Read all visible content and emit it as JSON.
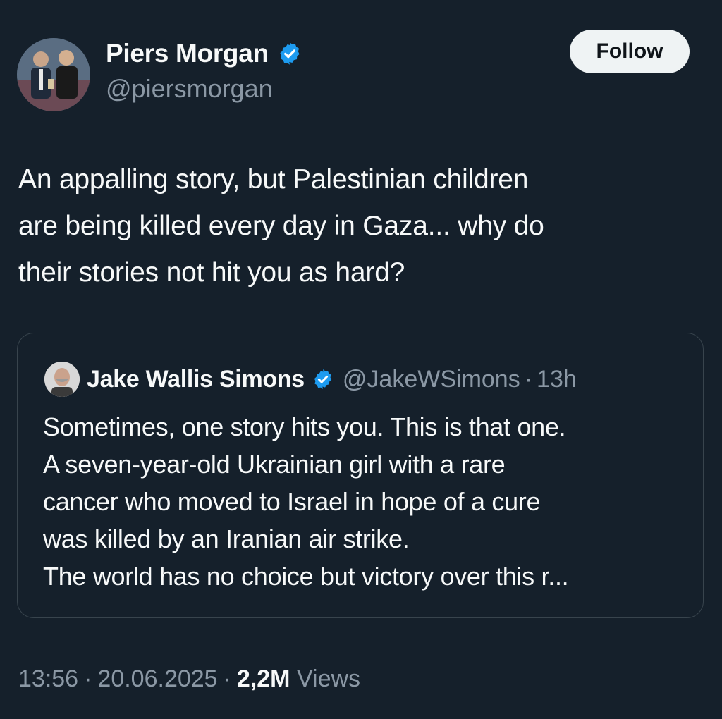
{
  "tweet": {
    "author": {
      "display_name": "Piers Morgan",
      "handle": "@piersmorgan",
      "verified_icon": "verified-badge-icon",
      "avatar": "profile-photo"
    },
    "follow_label": "Follow",
    "text": "An appalling story, but Palestinian children\nare being killed every day in Gaza... why do\ntheir stories not hit you as hard?",
    "quoted": {
      "display_name": "Jake Wallis Simons",
      "handle": "@JakeWSimons",
      "dot": "·",
      "time": "13h",
      "text": "Sometimes, one story hits you. This is that one.\nA seven-year-old Ukrainian girl with a rare\ncancer who moved to Israel in hope of a cure\nwas killed by an Iranian air strike.\nThe world has no choice but victory over this r..."
    },
    "meta": {
      "time": "13:56",
      "date": "20.06.2025",
      "separator": "·",
      "views_count": "2,2M",
      "views_label": "Views"
    }
  },
  "colors": {
    "background": "#15202b",
    "text_primary": "#f7f9f9",
    "text_secondary": "#8b98a5",
    "verified_blue": "#1d9bf0",
    "border": "#38444d",
    "follow_bg": "#eff3f4"
  }
}
